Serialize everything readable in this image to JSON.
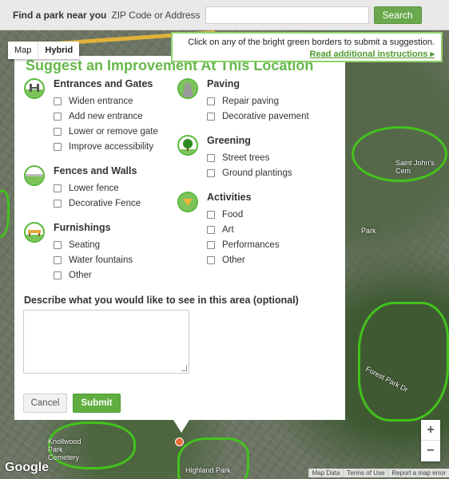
{
  "topbar": {
    "find_label": "Find a park near you",
    "zip_label": "ZIP Code or Address",
    "search_value": "",
    "search_button": "Search"
  },
  "map": {
    "type_options": [
      "Map",
      "Hybrid"
    ],
    "selected_type": "Hybrid",
    "labels": [
      "Saint John's Cem",
      "Park",
      "Forest Park Dr",
      "Knollwood Park Cemetery",
      "Highland Park"
    ],
    "zoom_in": "+",
    "zoom_out": "−",
    "logo": "Google",
    "attribution": [
      "Map Data",
      "Terms of Use",
      "Report a map error"
    ]
  },
  "info_box": {
    "line1": "Click on any of the bright green borders to submit a suggestion.",
    "line2": "Read additional instructions ▸"
  },
  "panel": {
    "title": "Suggest an Improvement At This Location",
    "categories": [
      {
        "name": "Entrances and Gates",
        "icon": "gate-icon",
        "options": [
          "Widen entrance",
          "Add new entrance",
          "Lower or remove gate",
          "Improve accessibility"
        ]
      },
      {
        "name": "Fences and Walls",
        "icon": "fence-icon",
        "options": [
          "Lower fence",
          "Decorative Fence"
        ]
      },
      {
        "name": "Furnishings",
        "icon": "bench-icon",
        "options": [
          "Seating",
          "Water fountains",
          "Other"
        ]
      },
      {
        "name": "Paving",
        "icon": "paving-icon",
        "options": [
          "Repair paving",
          "Decorative pavement"
        ]
      },
      {
        "name": "Greening",
        "icon": "tree-icon",
        "options": [
          "Street trees",
          "Ground plantings"
        ]
      },
      {
        "name": "Activities",
        "icon": "activities-icon",
        "options": [
          "Food",
          "Art",
          "Performances",
          "Other"
        ]
      }
    ],
    "describe_label": "Describe what you would like to see in this area (optional)",
    "describe_value": "",
    "cancel": "Cancel",
    "submit": "Submit"
  },
  "colors": {
    "accent": "#5fae3f",
    "title": "#66b84a",
    "park_border": "#43c21d"
  }
}
